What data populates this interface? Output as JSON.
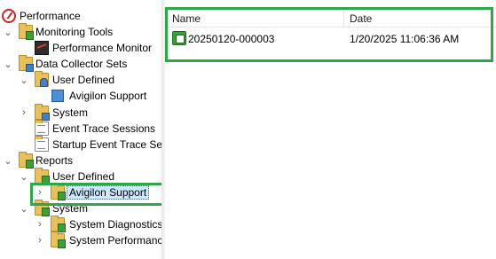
{
  "tree": {
    "root": {
      "label": "Performance",
      "icon": "performance-icon"
    },
    "monitoring_tools": {
      "label": "Monitoring Tools",
      "icon": "folder-chart-icon"
    },
    "performance_monitor": {
      "label": "Performance Monitor",
      "icon": "monitor-chart-icon"
    },
    "data_collector_sets": {
      "label": "Data Collector Sets",
      "icon": "folder-data-icon"
    },
    "dcs_user_defined": {
      "label": "User Defined",
      "icon": "folder-user-icon"
    },
    "dcs_avigilon_support": {
      "label": "Avigilon Support",
      "icon": "data-collector-icon"
    },
    "dcs_system": {
      "label": "System",
      "icon": "folder-icon"
    },
    "event_trace_sessions": {
      "label": "Event Trace Sessions",
      "icon": "folder-trace-icon"
    },
    "startup_event_trace": {
      "label": "Startup Event Trace Sess",
      "icon": "folder-trace-icon"
    },
    "reports": {
      "label": "Reports",
      "icon": "folder-report-icon"
    },
    "reports_user_defined": {
      "label": "User Defined",
      "icon": "folder-user-icon"
    },
    "reports_avigilon_support": {
      "label": "Avigilon Support",
      "icon": "folder-report-icon",
      "selected": true
    },
    "reports_system": {
      "label": "System",
      "icon": "folder-system-icon"
    },
    "system_diagnostics": {
      "label": "System Diagnostics",
      "icon": "folder-report-icon"
    },
    "system_performance": {
      "label": "System Performanc",
      "icon": "folder-report-icon"
    }
  },
  "list": {
    "columns": {
      "name": "Name",
      "date": "Date"
    },
    "rows": [
      {
        "name": "20250120-000003",
        "date": "1/20/2025 11:06:36 AM",
        "icon": "report-icon"
      }
    ]
  },
  "highlight_color": "#2aa84a",
  "selection_color": "#cce8ff"
}
